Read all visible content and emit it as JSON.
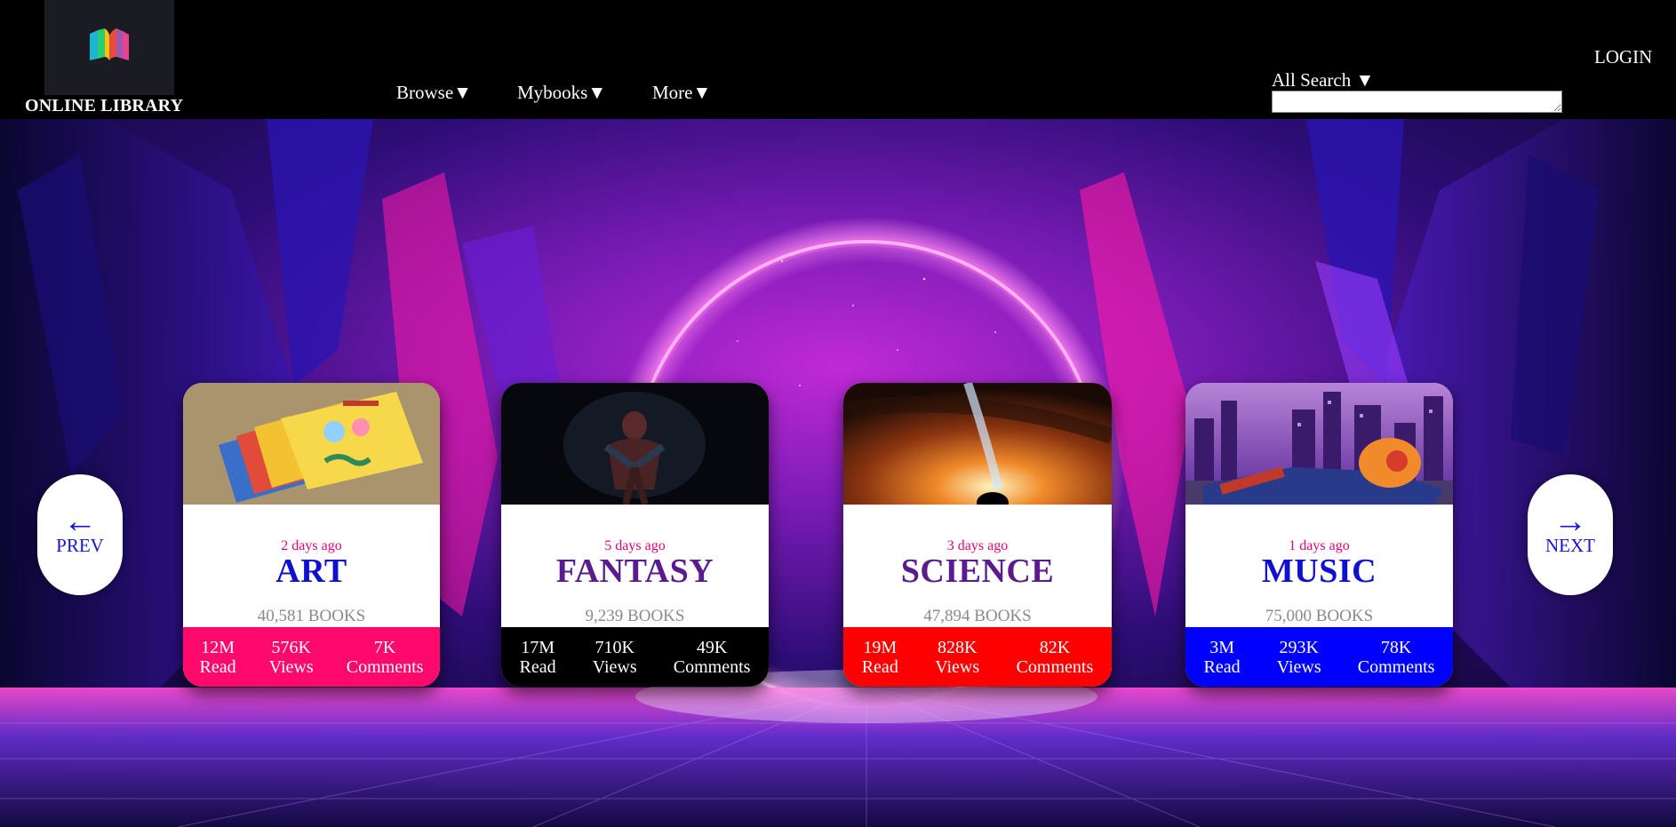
{
  "app": {
    "name": "ONLINE LIBRARY"
  },
  "nav": {
    "browse": "Browse▼",
    "mybooks": "Mybooks▼",
    "more": "More▼"
  },
  "search": {
    "label": "All Search ▼",
    "value": "",
    "placeholder": ""
  },
  "login": "LOGIN",
  "slider": {
    "prev": {
      "icon": "left-arrow-icon",
      "glyph": "←",
      "label": "PREV"
    },
    "next": {
      "icon": "right-arrow-icon",
      "glyph": "→",
      "label": "NEXT"
    }
  },
  "cards": [
    {
      "image": "stack-of-childrens-books-image",
      "time": "2 days ago",
      "title": "ART",
      "books": "40,581 BOOKS",
      "title_color": "#1010d0",
      "stats_color": "#ff0a6c",
      "stats": [
        {
          "value": "12M",
          "label": "Read"
        },
        {
          "value": "576K",
          "label": "Views"
        },
        {
          "value": "7K",
          "label": "Comments"
        }
      ]
    },
    {
      "image": "spiderman-dark-image",
      "time": "5 days ago",
      "title": "FANTASY",
      "books": "9,239 BOOKS",
      "title_color": "#5b1a8e",
      "stats_color": "#000000",
      "stats": [
        {
          "value": "17M",
          "label": "Read"
        },
        {
          "value": "710K",
          "label": "Views"
        },
        {
          "value": "49K",
          "label": "Comments"
        }
      ]
    },
    {
      "image": "black-hole-image",
      "time": "3 days ago",
      "title": "SCIENCE",
      "books": "47,894 BOOKS",
      "title_color": "#5b1a8e",
      "stats_color": "#ff0000",
      "stats": [
        {
          "value": "19M",
          "label": "Read"
        },
        {
          "value": "828K",
          "label": "Views"
        },
        {
          "value": "82K",
          "label": "Comments"
        }
      ]
    },
    {
      "image": "spiderman-city-image",
      "time": "1 days ago",
      "title": "MUSIC",
      "books": "75,000 BOOKS",
      "title_color": "#1010d0",
      "stats_color": "#0000ff",
      "stats": [
        {
          "value": "3M",
          "label": "Read"
        },
        {
          "value": "293K",
          "label": "Views"
        },
        {
          "value": "78K",
          "label": "Comments"
        }
      ]
    }
  ]
}
